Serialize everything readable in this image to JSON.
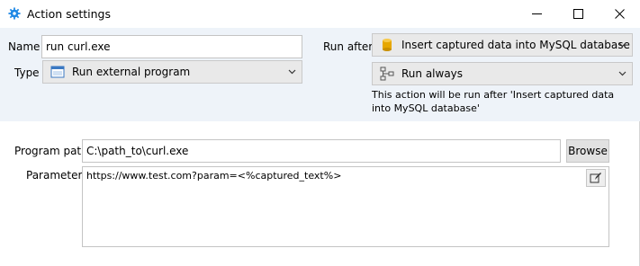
{
  "window": {
    "title": "Action settings",
    "icon": "gear-icon"
  },
  "form": {
    "name_label": "Name",
    "name_value": "run curl.exe",
    "type_label": "Type",
    "type_value": "Run external program",
    "type_icon": "window-icon",
    "run_after_label": "Run after",
    "run_after_value": "Insert captured data into MySQL database",
    "run_after_icon": "database-icon",
    "condition_value": "Run always",
    "condition_icon": "flow-icon",
    "info_text": "This action will be run after 'Insert captured data into MySQL database'"
  },
  "program": {
    "path_label": "Program path",
    "path_value": "C:\\path_to\\curl.exe",
    "browse_label": "Browse",
    "parameters_label": "Parameters",
    "parameters_value": "https://www.test.com?param=<%captured_text%>",
    "edit_icon": "edit-icon"
  },
  "colors": {
    "panel_bg": "#eef3f9",
    "combo_bg": "#e9e9e9",
    "gear_icon": "#1e88e5",
    "database_icon": "#e6a700"
  }
}
